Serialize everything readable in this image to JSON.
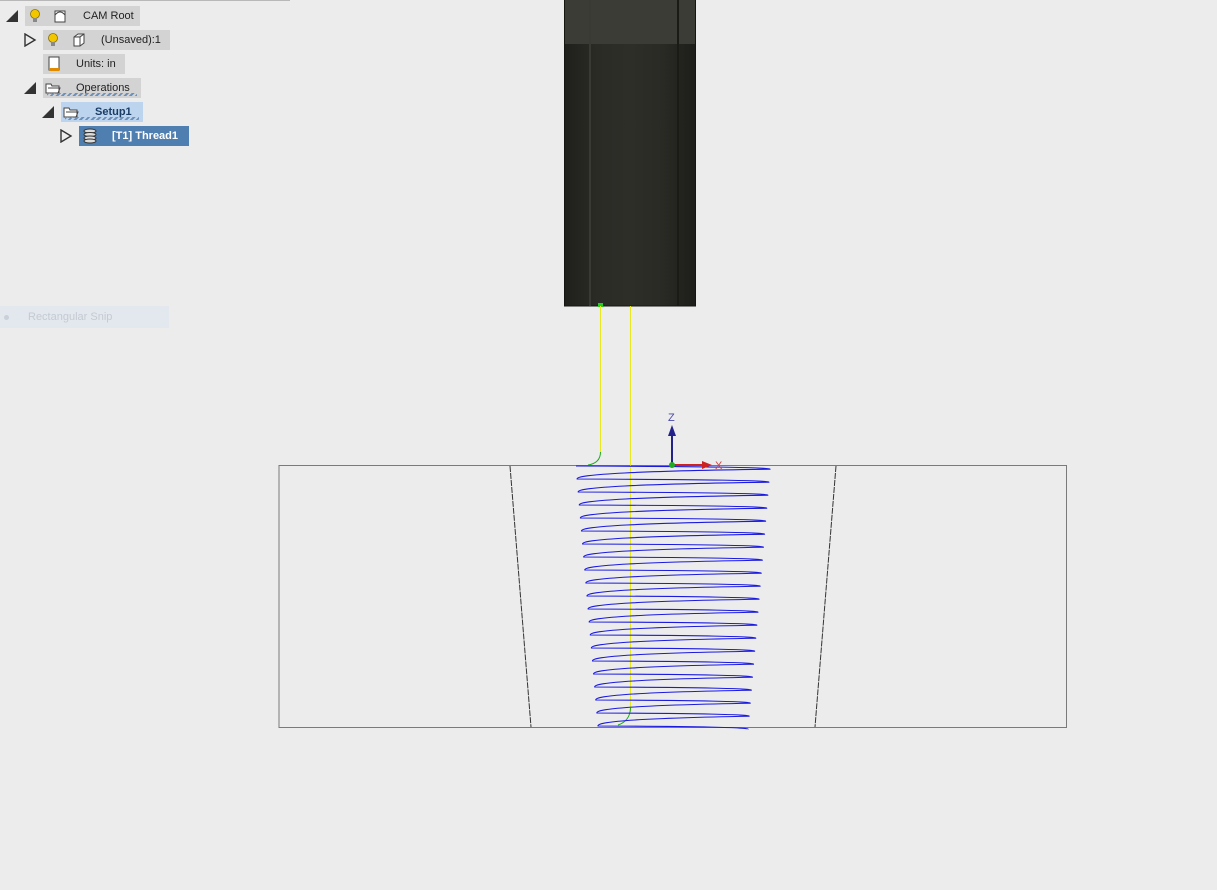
{
  "browser": {
    "items": [
      {
        "label": "CAM Root",
        "expanded": true
      },
      {
        "label": "(Unsaved):1",
        "expanded": false
      },
      {
        "label": "Units: in"
      },
      {
        "label": "Operations",
        "expanded": true
      },
      {
        "label": "Setup1",
        "expanded": true
      },
      {
        "label": "[T1] Thread1",
        "expanded": false,
        "selected": true
      }
    ]
  },
  "overlay": {
    "snip_label": "Rectangular Snip"
  },
  "triad": {
    "z_label": "Z",
    "x_label": "X"
  },
  "colors": {
    "background": "#ececec",
    "toolpath": "#1a1ae0",
    "rapid": "#e8e820",
    "lead": "#1faa1f",
    "tool_body": "#262621",
    "x_axis": "#cc2222",
    "z_axis": "#22228a",
    "selection": "#4f7fb0"
  }
}
